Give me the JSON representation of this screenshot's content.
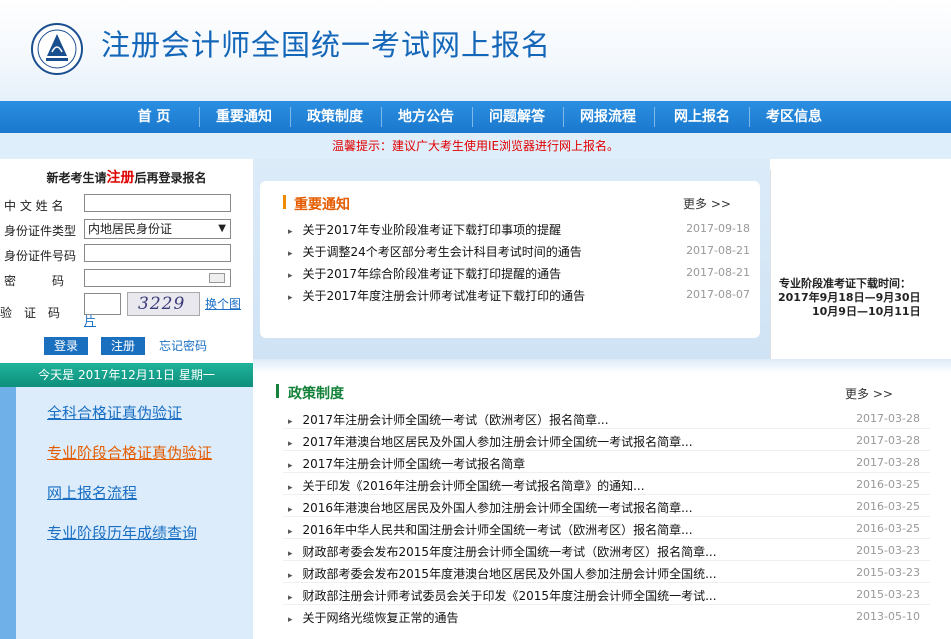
{
  "header": {
    "title": "注册会计师全国统一考试网上报名"
  },
  "nav": {
    "items": [
      "首 页",
      "重要通知",
      "政策制度",
      "地方公告",
      "问题解答",
      "网报流程",
      "网上报名",
      "考区信息"
    ]
  },
  "notice_bar": {
    "text": "温馨提示：建议广大考生使用IE浏览器进行网上报名。"
  },
  "login": {
    "heading_pre": "新老考生请",
    "heading_register": "注册",
    "heading_post": "后再登录报名",
    "labels": {
      "name": "中 文 姓 名",
      "id_type": "身份证件类型",
      "id_number": "身份证件号码",
      "password": "密　　　码",
      "captcha": "验　证　码"
    },
    "id_type_value": "内地居民身份证",
    "captcha_text": "3229",
    "change_pic": "换个图片",
    "login_button": "登录",
    "register_button": "注册",
    "forgot_link": "忘记密码"
  },
  "date_bar": {
    "text": "今天是 2017年12月11日 星期一"
  },
  "side_menu": {
    "items": [
      {
        "label": "全科合格证真伪验证"
      },
      {
        "label": "专业阶段合格证真伪验证"
      },
      {
        "label": "网上报名流程"
      },
      {
        "label": "专业阶段历年成绩查询"
      }
    ]
  },
  "notices": {
    "title": "重要通知",
    "more": "更多 >>",
    "items": [
      {
        "text": "关于2017年专业阶段准考证下载打印事项的提醒",
        "date": "2017-09-18"
      },
      {
        "text": "关于调整24个考区部分考生会计科目考试时间的通告",
        "date": "2017-08-21"
      },
      {
        "text": "关于2017年综合阶段准考证下载打印提醒的通告",
        "date": "2017-08-21"
      },
      {
        "text": "关于2017年度注册会计师考试准考证下载打印的通告",
        "date": "2017-08-07"
      }
    ]
  },
  "exam_info": {
    "title": "专业阶段准考证下载时间：",
    "line1": "2017年9月18日—9月30日",
    "line2": "10月9日—10月11日"
  },
  "policies": {
    "title": "政策制度",
    "more": "更多 >>",
    "items": [
      {
        "text": "2017年注册会计师全国统一考试（欧洲考区）报名简章...",
        "date": "2017-03-28"
      },
      {
        "text": "2017年港澳台地区居民及外国人参加注册会计师全国统一考试报名简章...",
        "date": "2017-03-28"
      },
      {
        "text": "2017年注册会计师全国统一考试报名简章",
        "date": "2017-03-28"
      },
      {
        "text": "关于印发《2016年注册会计师全国统一考试报名简章》的通知...",
        "date": "2016-03-25"
      },
      {
        "text": "2016年港澳台地区居民及外国人参加注册会计师全国统一考试报名简章...",
        "date": "2016-03-25"
      },
      {
        "text": "2016年中华人民共和国注册会计师全国统一考试（欧洲考区）报名简章...",
        "date": "2016-03-25"
      },
      {
        "text": "财政部考委会发布2015年度注册会计师全国统一考试（欧洲考区）报名简章...",
        "date": "2015-03-23"
      },
      {
        "text": "财政部考委会发布2015年度港澳台地区居民及外国人参加注册会计师全国统...",
        "date": "2015-03-23"
      },
      {
        "text": "财政部注册会计师考试委员会关于印发《2015年度注册会计师全国统一考试...",
        "date": "2015-03-23"
      },
      {
        "text": "关于网络光缆恢复正常的通告",
        "date": "2013-05-10"
      }
    ]
  },
  "colors": {
    "brand_blue": "#1466b8",
    "nav_blue": "#1a78cd",
    "accent_orange": "#e55c00",
    "notice_red": "#e00000",
    "date_teal": "#0e8f7c"
  }
}
